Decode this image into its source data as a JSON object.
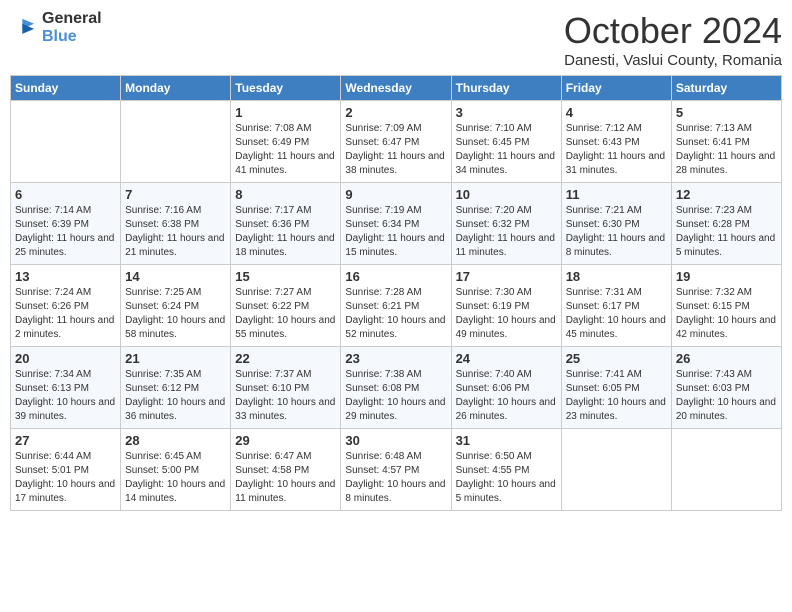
{
  "header": {
    "logo_general": "General",
    "logo_blue": "Blue",
    "month_title": "October 2024",
    "location": "Danesti, Vaslui County, Romania"
  },
  "weekdays": [
    "Sunday",
    "Monday",
    "Tuesday",
    "Wednesday",
    "Thursday",
    "Friday",
    "Saturday"
  ],
  "weeks": [
    [
      {
        "day": "",
        "sunrise": "",
        "sunset": "",
        "daylight": ""
      },
      {
        "day": "",
        "sunrise": "",
        "sunset": "",
        "daylight": ""
      },
      {
        "day": "1",
        "sunrise": "Sunrise: 7:08 AM",
        "sunset": "Sunset: 6:49 PM",
        "daylight": "Daylight: 11 hours and 41 minutes."
      },
      {
        "day": "2",
        "sunrise": "Sunrise: 7:09 AM",
        "sunset": "Sunset: 6:47 PM",
        "daylight": "Daylight: 11 hours and 38 minutes."
      },
      {
        "day": "3",
        "sunrise": "Sunrise: 7:10 AM",
        "sunset": "Sunset: 6:45 PM",
        "daylight": "Daylight: 11 hours and 34 minutes."
      },
      {
        "day": "4",
        "sunrise": "Sunrise: 7:12 AM",
        "sunset": "Sunset: 6:43 PM",
        "daylight": "Daylight: 11 hours and 31 minutes."
      },
      {
        "day": "5",
        "sunrise": "Sunrise: 7:13 AM",
        "sunset": "Sunset: 6:41 PM",
        "daylight": "Daylight: 11 hours and 28 minutes."
      }
    ],
    [
      {
        "day": "6",
        "sunrise": "Sunrise: 7:14 AM",
        "sunset": "Sunset: 6:39 PM",
        "daylight": "Daylight: 11 hours and 25 minutes."
      },
      {
        "day": "7",
        "sunrise": "Sunrise: 7:16 AM",
        "sunset": "Sunset: 6:38 PM",
        "daylight": "Daylight: 11 hours and 21 minutes."
      },
      {
        "day": "8",
        "sunrise": "Sunrise: 7:17 AM",
        "sunset": "Sunset: 6:36 PM",
        "daylight": "Daylight: 11 hours and 18 minutes."
      },
      {
        "day": "9",
        "sunrise": "Sunrise: 7:19 AM",
        "sunset": "Sunset: 6:34 PM",
        "daylight": "Daylight: 11 hours and 15 minutes."
      },
      {
        "day": "10",
        "sunrise": "Sunrise: 7:20 AM",
        "sunset": "Sunset: 6:32 PM",
        "daylight": "Daylight: 11 hours and 11 minutes."
      },
      {
        "day": "11",
        "sunrise": "Sunrise: 7:21 AM",
        "sunset": "Sunset: 6:30 PM",
        "daylight": "Daylight: 11 hours and 8 minutes."
      },
      {
        "day": "12",
        "sunrise": "Sunrise: 7:23 AM",
        "sunset": "Sunset: 6:28 PM",
        "daylight": "Daylight: 11 hours and 5 minutes."
      }
    ],
    [
      {
        "day": "13",
        "sunrise": "Sunrise: 7:24 AM",
        "sunset": "Sunset: 6:26 PM",
        "daylight": "Daylight: 11 hours and 2 minutes."
      },
      {
        "day": "14",
        "sunrise": "Sunrise: 7:25 AM",
        "sunset": "Sunset: 6:24 PM",
        "daylight": "Daylight: 10 hours and 58 minutes."
      },
      {
        "day": "15",
        "sunrise": "Sunrise: 7:27 AM",
        "sunset": "Sunset: 6:22 PM",
        "daylight": "Daylight: 10 hours and 55 minutes."
      },
      {
        "day": "16",
        "sunrise": "Sunrise: 7:28 AM",
        "sunset": "Sunset: 6:21 PM",
        "daylight": "Daylight: 10 hours and 52 minutes."
      },
      {
        "day": "17",
        "sunrise": "Sunrise: 7:30 AM",
        "sunset": "Sunset: 6:19 PM",
        "daylight": "Daylight: 10 hours and 49 minutes."
      },
      {
        "day": "18",
        "sunrise": "Sunrise: 7:31 AM",
        "sunset": "Sunset: 6:17 PM",
        "daylight": "Daylight: 10 hours and 45 minutes."
      },
      {
        "day": "19",
        "sunrise": "Sunrise: 7:32 AM",
        "sunset": "Sunset: 6:15 PM",
        "daylight": "Daylight: 10 hours and 42 minutes."
      }
    ],
    [
      {
        "day": "20",
        "sunrise": "Sunrise: 7:34 AM",
        "sunset": "Sunset: 6:13 PM",
        "daylight": "Daylight: 10 hours and 39 minutes."
      },
      {
        "day": "21",
        "sunrise": "Sunrise: 7:35 AM",
        "sunset": "Sunset: 6:12 PM",
        "daylight": "Daylight: 10 hours and 36 minutes."
      },
      {
        "day": "22",
        "sunrise": "Sunrise: 7:37 AM",
        "sunset": "Sunset: 6:10 PM",
        "daylight": "Daylight: 10 hours and 33 minutes."
      },
      {
        "day": "23",
        "sunrise": "Sunrise: 7:38 AM",
        "sunset": "Sunset: 6:08 PM",
        "daylight": "Daylight: 10 hours and 29 minutes."
      },
      {
        "day": "24",
        "sunrise": "Sunrise: 7:40 AM",
        "sunset": "Sunset: 6:06 PM",
        "daylight": "Daylight: 10 hours and 26 minutes."
      },
      {
        "day": "25",
        "sunrise": "Sunrise: 7:41 AM",
        "sunset": "Sunset: 6:05 PM",
        "daylight": "Daylight: 10 hours and 23 minutes."
      },
      {
        "day": "26",
        "sunrise": "Sunrise: 7:43 AM",
        "sunset": "Sunset: 6:03 PM",
        "daylight": "Daylight: 10 hours and 20 minutes."
      }
    ],
    [
      {
        "day": "27",
        "sunrise": "Sunrise: 6:44 AM",
        "sunset": "Sunset: 5:01 PM",
        "daylight": "Daylight: 10 hours and 17 minutes."
      },
      {
        "day": "28",
        "sunrise": "Sunrise: 6:45 AM",
        "sunset": "Sunset: 5:00 PM",
        "daylight": "Daylight: 10 hours and 14 minutes."
      },
      {
        "day": "29",
        "sunrise": "Sunrise: 6:47 AM",
        "sunset": "Sunset: 4:58 PM",
        "daylight": "Daylight: 10 hours and 11 minutes."
      },
      {
        "day": "30",
        "sunrise": "Sunrise: 6:48 AM",
        "sunset": "Sunset: 4:57 PM",
        "daylight": "Daylight: 10 hours and 8 minutes."
      },
      {
        "day": "31",
        "sunrise": "Sunrise: 6:50 AM",
        "sunset": "Sunset: 4:55 PM",
        "daylight": "Daylight: 10 hours and 5 minutes."
      },
      {
        "day": "",
        "sunrise": "",
        "sunset": "",
        "daylight": ""
      },
      {
        "day": "",
        "sunrise": "",
        "sunset": "",
        "daylight": ""
      }
    ]
  ]
}
